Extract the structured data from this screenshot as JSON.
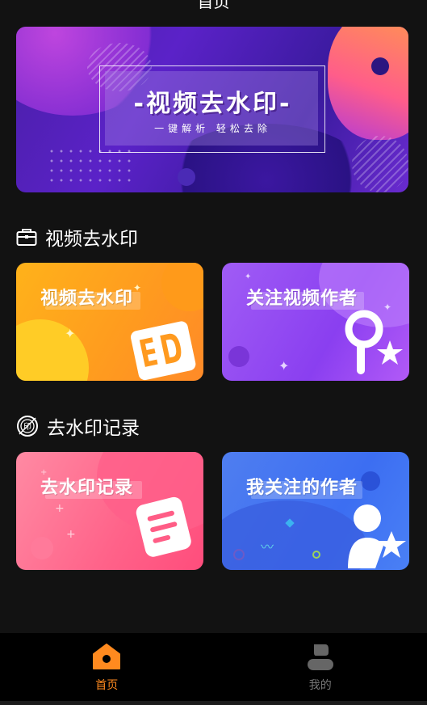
{
  "header": {
    "title": "首页"
  },
  "banner": {
    "headline": "-视频去水印-",
    "subtitle": "一键解析 轻松去除"
  },
  "sections": [
    {
      "icon": "briefcase-icon",
      "title": "视频去水印"
    },
    {
      "icon": "stamp-icon",
      "title": "去水印记录"
    }
  ],
  "cards": {
    "remove_watermark": "视频去水印",
    "follow_author": "关注视频作者",
    "records": "去水印记录",
    "my_followed": "我关注的作者"
  },
  "bottom_nav": {
    "home": "首页",
    "me": "我的"
  },
  "colors": {
    "background": "#121212",
    "active_tab": "#ff8a1f",
    "inactive_tab": "#777777"
  }
}
